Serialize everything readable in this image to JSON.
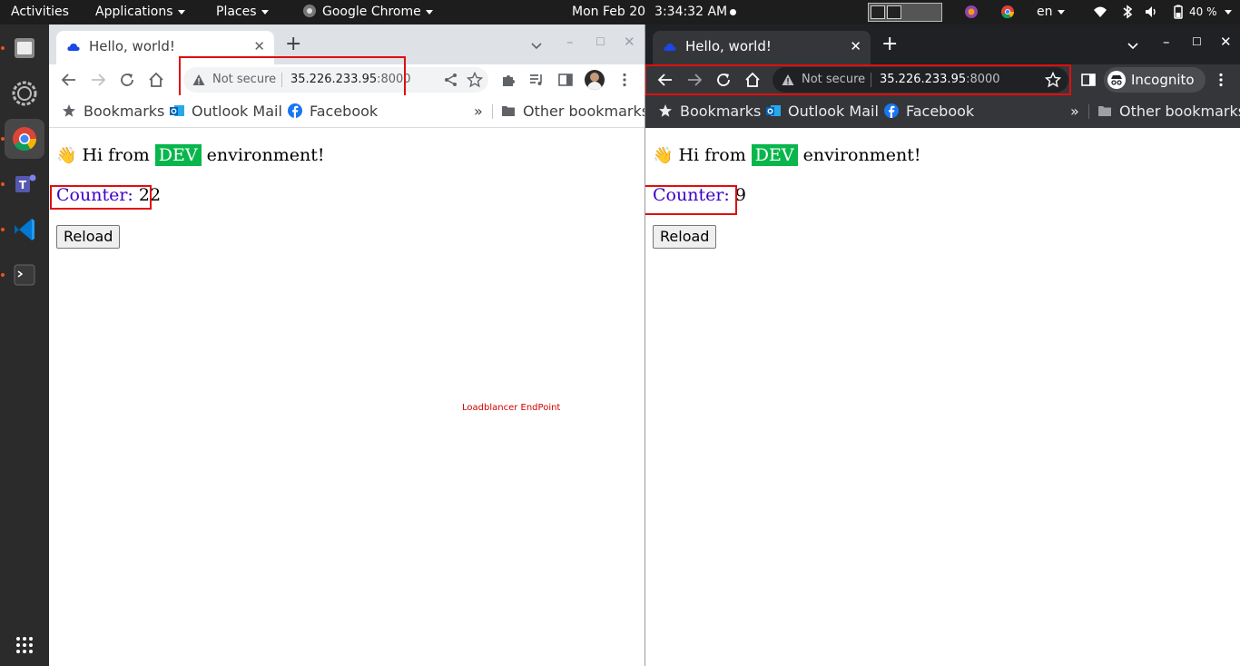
{
  "topbar": {
    "activities": "Activities",
    "applications": "Applications",
    "places": "Places",
    "app_name": "Google Chrome",
    "date": "Mon Feb 20",
    "time": "3:34:32 AM",
    "language": "en",
    "battery": "40 %"
  },
  "dock": {
    "items": [
      "files-icon",
      "settings-icon",
      "chrome-icon",
      "teams-icon",
      "vscode-icon",
      "terminal-icon",
      "apps-grid-icon"
    ]
  },
  "left_window": {
    "tab_title": "Hello, world!",
    "not_secure": "Not secure",
    "url_host": "35.226.233.95",
    "url_port": ":8000",
    "bookmarks": {
      "bookmarks": "Bookmarks",
      "outlook": "Outlook Mail",
      "facebook": "Facebook",
      "more": "»",
      "other": "Other bookmarks"
    },
    "page": {
      "greeting_emoji": "👋",
      "greeting_pre": "Hi from",
      "env": "DEV",
      "greeting_post": "environment!",
      "counter_label": "Counter:",
      "counter_value": "22",
      "reload": "Reload"
    },
    "annotation": "Loadblancer EndPoint"
  },
  "right_window": {
    "tab_title": "Hello, world!",
    "not_secure": "Not secure",
    "url_host": "35.226.233.95",
    "url_port": ":8000",
    "incognito": "Incognito",
    "bookmarks": {
      "bookmarks": "Bookmarks",
      "outlook": "Outlook Mail",
      "facebook": "Facebook",
      "more": "»",
      "other": "Other bookmarks"
    },
    "page": {
      "greeting_emoji": "👋",
      "greeting_pre": "Hi from",
      "env": "DEV",
      "greeting_post": "environment!",
      "counter_label": "Counter:",
      "counter_value": "9",
      "reload": "Reload"
    }
  },
  "colors": {
    "annotation_red": "#e10e0e",
    "dev_green": "#08b64c",
    "counter_label": "#3d00c6",
    "ubuntu_orange": "#e95420"
  }
}
